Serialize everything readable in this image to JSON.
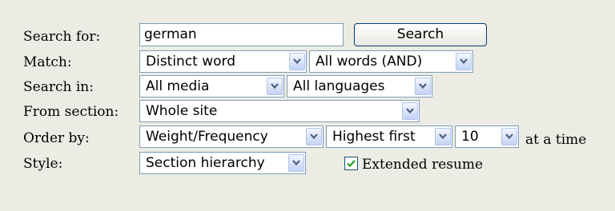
{
  "labels": {
    "search_for": "Search for:",
    "match": "Match:",
    "search_in": "Search in:",
    "from_section": "From section:",
    "order_by": "Order by:",
    "style": "Style:"
  },
  "search": {
    "value": "german",
    "button_label": "Search"
  },
  "match": {
    "word_mode": "Distinct word",
    "logic": "All words (AND)"
  },
  "search_in": {
    "media": "All media",
    "languages": "All languages"
  },
  "from_section": {
    "value": "Whole site"
  },
  "order_by": {
    "field": "Weight/Frequency",
    "direction": "Highest first",
    "count": "10",
    "suffix": "at a time"
  },
  "style": {
    "value": "Section hierarchy",
    "extended_resume_label": "Extended resume",
    "extended_resume_checked": true
  },
  "icons": {
    "dropdown": "chevron-down-icon",
    "check": "check-icon"
  },
  "colors": {
    "background": "#ecece4",
    "field_border": "#7f9db9",
    "button_border": "#003c74",
    "check": "#21a121"
  }
}
